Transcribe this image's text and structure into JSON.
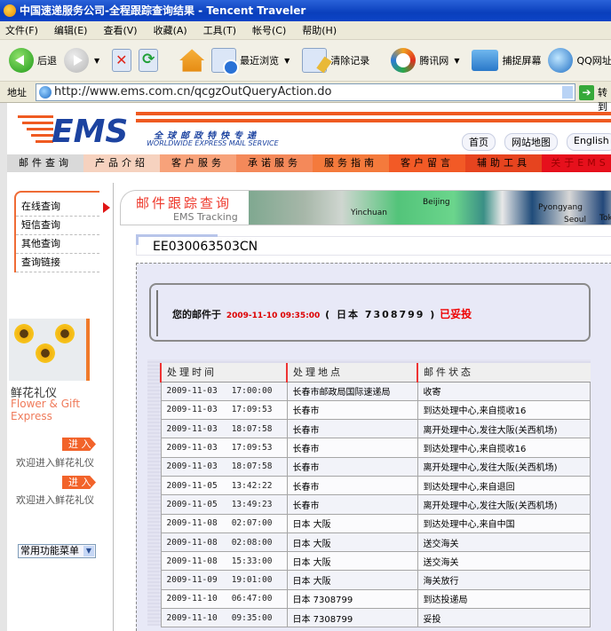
{
  "window": {
    "title": "中国速递服务公司-全程跟踪查询结果 - Tencent Traveler"
  },
  "menu": [
    "文件(F)",
    "编辑(E)",
    "查看(V)",
    "收藏(A)",
    "工具(T)",
    "帐号(C)",
    "帮助(H)"
  ],
  "toolbar": {
    "back": "后退",
    "history": "最近浏览",
    "clear": "清除记录",
    "tencent": "腾讯网",
    "capture": "捕捉屏幕",
    "qq": "QQ网址"
  },
  "address": {
    "label": "地址",
    "url": "http://www.ems.com.cn/qcgzOutQueryAction.do",
    "go": "转到"
  },
  "site": {
    "logo": "EMS",
    "logo_cn": "全球邮政特快专递",
    "logo_en": "WORLDWIDE EXPRESS MAIL SERVICE",
    "toplinks": [
      "首页",
      "网站地图",
      "English"
    ],
    "nav": [
      {
        "label": "邮件查询",
        "color": "#d9d9d9"
      },
      {
        "label": "产品介绍",
        "color": "#f6d2bf"
      },
      {
        "label": "客户服务",
        "color": "#f7a27a"
      },
      {
        "label": "承诺服务",
        "color": "#f4895a"
      },
      {
        "label": "服务指南",
        "color": "#f47a3c"
      },
      {
        "label": "客户留言",
        "color": "#f25a26"
      },
      {
        "label": "辅助工具",
        "color": "#e6441f"
      },
      {
        "label": "关于EMS",
        "color": "#e6101c"
      }
    ],
    "leftnav": [
      "在线查询",
      "短信查询",
      "其他查询",
      "查询链接"
    ],
    "promo": {
      "cn": "鲜花礼仪",
      "en": "Flower & Gift Express",
      "enter": "进 入",
      "welcome": "欢迎进入鲜花礼仪"
    },
    "quickmenu": "常用功能菜单",
    "banner": {
      "cn": "邮件跟踪查询",
      "en": "EMS Tracking",
      "cities": [
        "Beijing",
        "Pyongyang",
        "Seoul",
        "Tokyo",
        "Yinchuan"
      ]
    }
  },
  "tracking": {
    "number": "EE030063503CN",
    "summary": {
      "prefix": "您的邮件于",
      "datetime": "2009-11-10 09:35:00",
      "location": "( 日本  7308799 )",
      "status": "已妥投"
    },
    "columns": [
      "处理时间",
      "处理地点",
      "邮件状态"
    ],
    "rows": [
      {
        "date": "2009-11-03",
        "time": "17:00:00",
        "place": "长春市邮政局国际速递局",
        "status": "收寄"
      },
      {
        "date": "2009-11-03",
        "time": "17:09:53",
        "place": "长春市",
        "status": "到达处理中心,来自揽收16"
      },
      {
        "date": "2009-11-03",
        "time": "18:07:58",
        "place": "长春市",
        "status": "离开处理中心,发往大阪(关西机场)"
      },
      {
        "date": "2009-11-03",
        "time": "17:09:53",
        "place": "长春市",
        "status": "到达处理中心,来自揽收16"
      },
      {
        "date": "2009-11-03",
        "time": "18:07:58",
        "place": "长春市",
        "status": "离开处理中心,发往大阪(关西机场)"
      },
      {
        "date": "2009-11-05",
        "time": "13:42:22",
        "place": "长春市",
        "status": "到达处理中心,来自退回"
      },
      {
        "date": "2009-11-05",
        "time": "13:49:23",
        "place": "长春市",
        "status": "离开处理中心,发往大阪(关西机场)"
      },
      {
        "date": "2009-11-08",
        "time": "02:07:00",
        "place": "日本 大阪",
        "status": "到达处理中心,来自中国"
      },
      {
        "date": "2009-11-08",
        "time": "02:08:00",
        "place": "日本 大阪",
        "status": "送交海关"
      },
      {
        "date": "2009-11-08",
        "time": "15:33:00",
        "place": "日本 大阪",
        "status": "送交海关"
      },
      {
        "date": "2009-11-09",
        "time": "19:01:00",
        "place": "日本 大阪",
        "status": "海关放行"
      },
      {
        "date": "2009-11-10",
        "time": "06:47:00",
        "place": "日本 7308799",
        "status": "到达投递局"
      },
      {
        "date": "2009-11-10",
        "time": "09:35:00",
        "place": "日本 7308799",
        "status": "妥投"
      }
    ]
  }
}
